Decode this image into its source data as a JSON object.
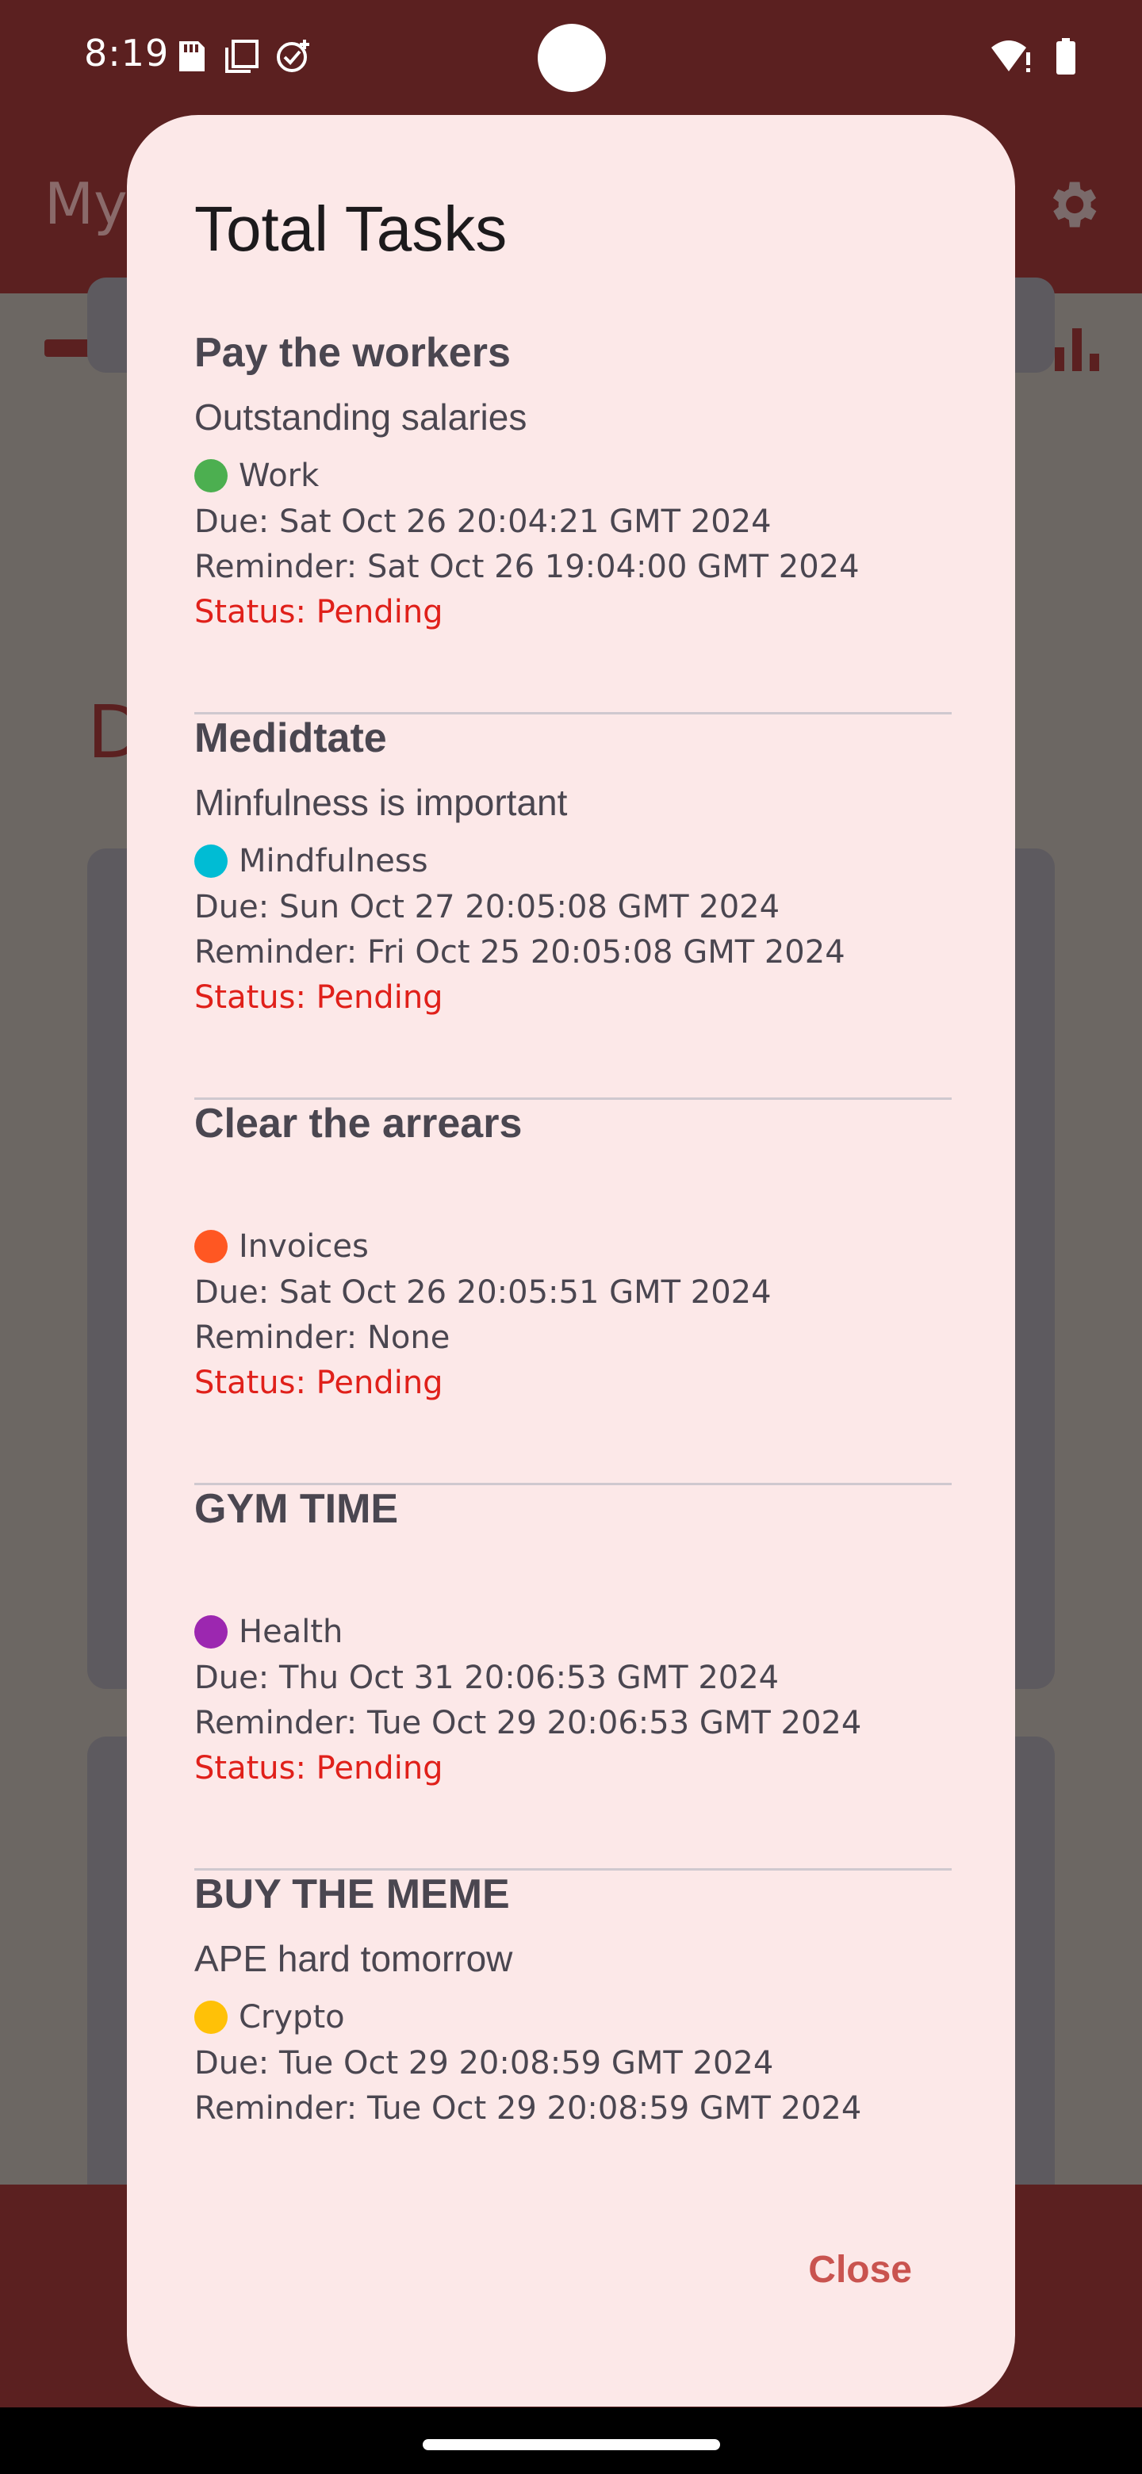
{
  "status_bar": {
    "time": "8:19",
    "left_icons": [
      "sd-card-icon",
      "copy-icon",
      "task-added-icon"
    ],
    "right_icons": [
      "wifi-alert-icon",
      "battery-icon"
    ]
  },
  "app_bar": {
    "title_partial": "My",
    "settings_icon": "gear-icon",
    "chart_icon": "bar-chart-icon",
    "background_letter": "D"
  },
  "dialog": {
    "title": "Total Tasks",
    "close_label": "Close",
    "tasks": [
      {
        "title": "Pay the workers",
        "description": "Outstanding salaries",
        "category": "Work",
        "category_color": "#4caf50",
        "due": "Due: Sat Oct 26 20:04:21 GMT 2024",
        "reminder": "Reminder: Sat Oct 26 19:04:00 GMT 2024",
        "status": "Status: Pending"
      },
      {
        "title": "Medidtate",
        "description": "Minfulness is important",
        "category": "Mindfulness",
        "category_color": "#00bcd4",
        "due": "Due: Sun Oct 27 20:05:08 GMT 2024",
        "reminder": "Reminder: Fri Oct 25 20:05:08 GMT 2024",
        "status": "Status: Pending"
      },
      {
        "title": "Clear the arrears",
        "description": "",
        "category": "Invoices",
        "category_color": "#ff5722",
        "due": "Due: Sat Oct 26 20:05:51 GMT 2024",
        "reminder": "Reminder: None",
        "status": "Status: Pending"
      },
      {
        "title": "GYM TIME",
        "description": "",
        "category": "Health",
        "category_color": "#9c27b0",
        "due": "Due: Thu Oct 31 20:06:53 GMT 2024",
        "reminder": "Reminder: Tue Oct 29 20:06:53 GMT 2024",
        "status": "Status: Pending"
      },
      {
        "title": "BUY THE MEME",
        "description": "APE hard tomorrow",
        "category": "Crypto",
        "category_color": "#ffc107",
        "due": "Due: Tue Oct 29 20:08:59 GMT 2024",
        "reminder": "Reminder: Tue Oct 29 20:08:59 GMT 2024",
        "status": ""
      }
    ]
  },
  "colors": {
    "app_primary": "#5b2020",
    "dialog_background": "#fce8e8",
    "status_pending": "#e0201a",
    "close_text": "#c9534f"
  }
}
